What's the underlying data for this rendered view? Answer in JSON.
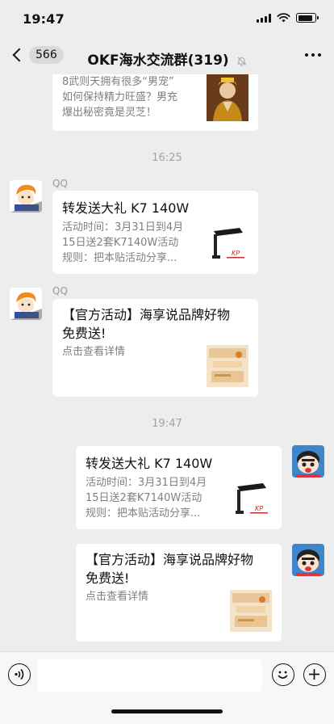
{
  "status_bar": {
    "time": "19:47",
    "battery_level": 0.85
  },
  "nav": {
    "unread_count": "566",
    "title": "OKF海水交流群(319)",
    "mute_icon": "bell-slash-icon",
    "more_icon": "more-icon"
  },
  "messages": {
    "top_card": {
      "desc": [
        "8武则天拥有很多“男宠”",
        "如何保持精力旺盛？男充",
        "爆出秘密竟是灵芝！"
      ]
    },
    "time_1": "16:25",
    "msg_1": {
      "sender": "QQ",
      "title": "转发送大礼 K7 140W",
      "desc": [
        "活动时间：3月31日到4月",
        "15日送2套K7140W活动",
        "规则：把本贴活动分享..."
      ]
    },
    "msg_2": {
      "sender": "QQ",
      "title": [
        "【官方活动】海享说品牌好物",
        "免费送!"
      ],
      "desc": "点击查看详情"
    },
    "time_2": "19:47",
    "msg_3": {
      "title": "转发送大礼 K7 140W",
      "desc": [
        "活动时间：3月31日到4月",
        "15日送2套K7140W活动",
        "规则：把本贴活动分享..."
      ]
    },
    "msg_4": {
      "title": [
        "【官方活动】海享说品牌好物",
        "免费送!"
      ],
      "desc": "点击查看详情"
    }
  },
  "input_bar": {
    "voice_icon": "voice-icon",
    "emoji_icon": "emoji-icon",
    "plus_icon": "plus-icon"
  },
  "colors": {
    "background": "#ededed",
    "card": "#ffffff",
    "muted_text": "#7f7f7f"
  }
}
